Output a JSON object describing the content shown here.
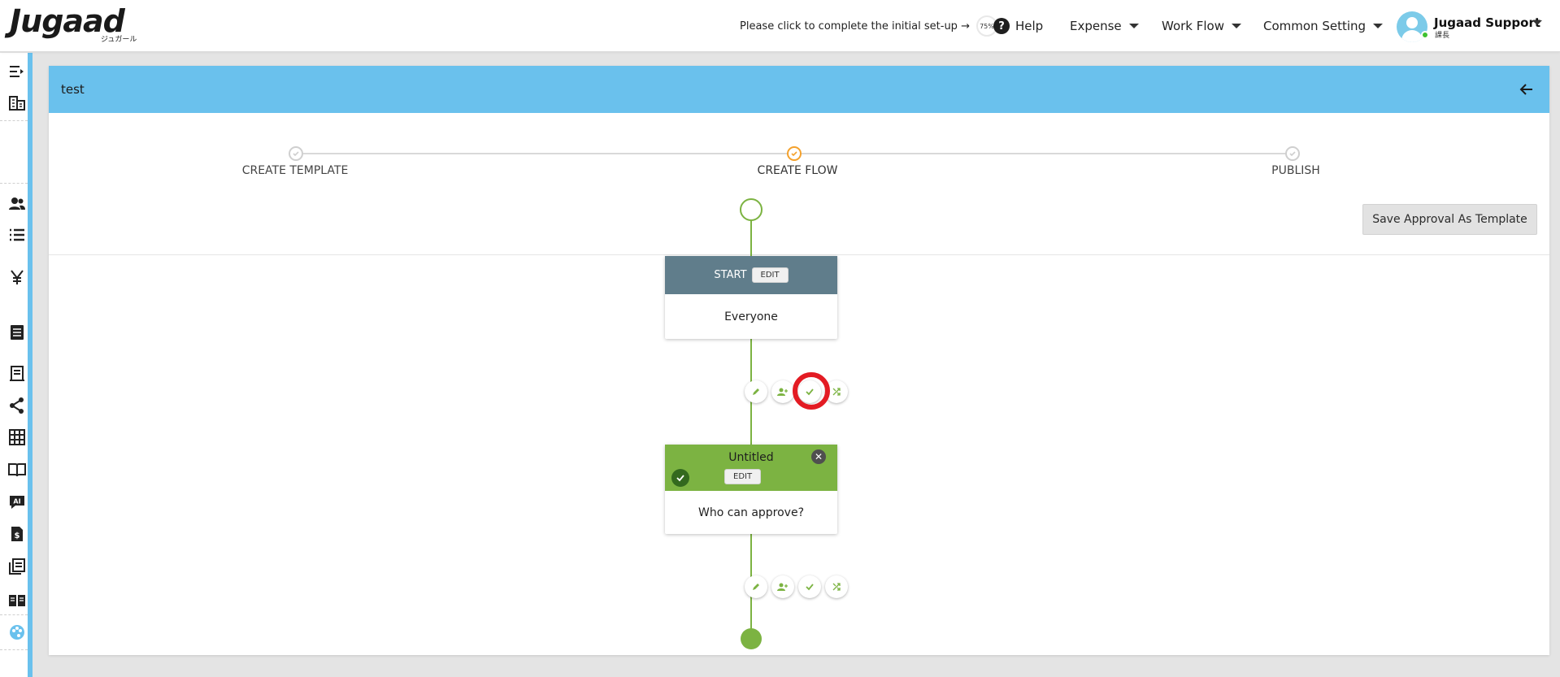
{
  "header": {
    "logo_text": "Jugaad",
    "logo_sub": "ジュガール",
    "setup_text": "Please click to complete the initial set-up →",
    "setup_progress": "75%",
    "help_label": "Help",
    "menus": [
      {
        "label": "Expense"
      },
      {
        "label": "Work Flow"
      },
      {
        "label": "Common Setting"
      }
    ],
    "user_name": "Jugaad Support",
    "user_role": "課長"
  },
  "sidebar": {
    "items": [
      "collapse-menu-icon",
      "company-icon",
      "users-icon",
      "list-icon",
      "yen-icon",
      "document-icon",
      "receipt-icon",
      "share-icon",
      "table-icon",
      "book-icon",
      "ai-chat-icon",
      "invoice-icon",
      "library-icon",
      "manual-icon",
      "palette-icon"
    ]
  },
  "panel": {
    "title": "test",
    "steps": [
      {
        "label": "CREATE TEMPLATE",
        "state": "done"
      },
      {
        "label": "CREATE FLOW",
        "state": "active"
      },
      {
        "label": "PUBLISH",
        "state": "pending"
      }
    ],
    "save_button": "Save Approval As Template"
  },
  "flow": {
    "start_node": {
      "title": "START",
      "edit": "EDIT",
      "body": "Everyone"
    },
    "approval_node": {
      "title": "Untitled",
      "edit": "EDIT",
      "body": "Who can approve?"
    },
    "tools": [
      "edit-icon",
      "add-approver-icon",
      "approve-icon",
      "branch-icon"
    ]
  },
  "colors": {
    "accent_blue": "#6ac1ed",
    "flow_green": "#7cb342",
    "start_header": "#607d8b",
    "highlight_red": "#e31b23",
    "step_active": "#f4a12c"
  }
}
